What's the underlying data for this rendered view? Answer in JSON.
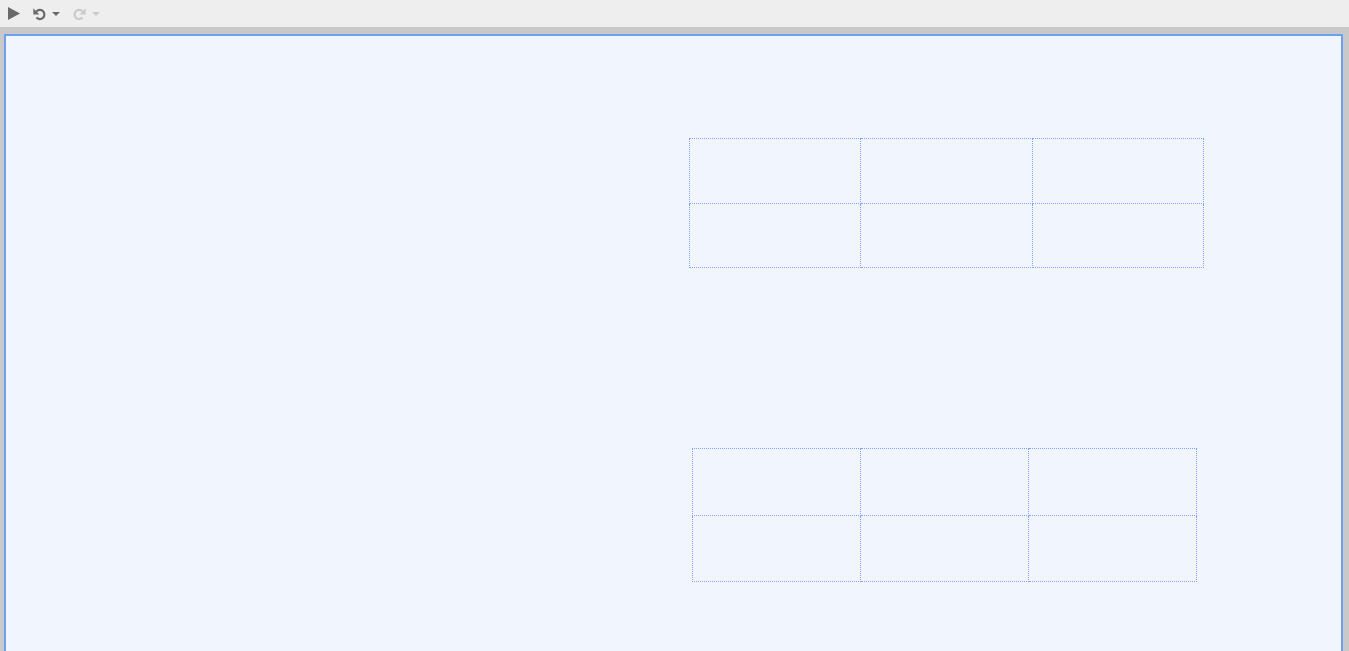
{
  "toolbar": {
    "buttons": [
      {
        "kind": "run",
        "disabled": false,
        "dropdown": false
      },
      {
        "kind": "undo",
        "disabled": false,
        "dropdown": true
      },
      {
        "kind": "redo",
        "disabled": true,
        "dropdown": true
      }
    ]
  },
  "canvas": {
    "focused": true,
    "tables": [
      {
        "rows": [
          {
            "cells": [
              {
                "kind": "empty"
              },
              {
                "kind": "empty"
              },
              {
                "kind": "empty"
              }
            ]
          },
          {
            "cells": [
              {
                "kind": "empty"
              },
              {
                "kind": "empty"
              },
              {
                "kind": "empty"
              }
            ]
          }
        ]
      },
      {
        "rows": [
          {
            "cells": [
              {
                "kind": "empty"
              },
              {
                "kind": "empty"
              },
              {
                "kind": "empty"
              }
            ]
          },
          {
            "cells": [
              {
                "kind": "empty"
              },
              {
                "kind": "empty"
              },
              {
                "kind": "empty"
              }
            ]
          }
        ]
      }
    ]
  }
}
